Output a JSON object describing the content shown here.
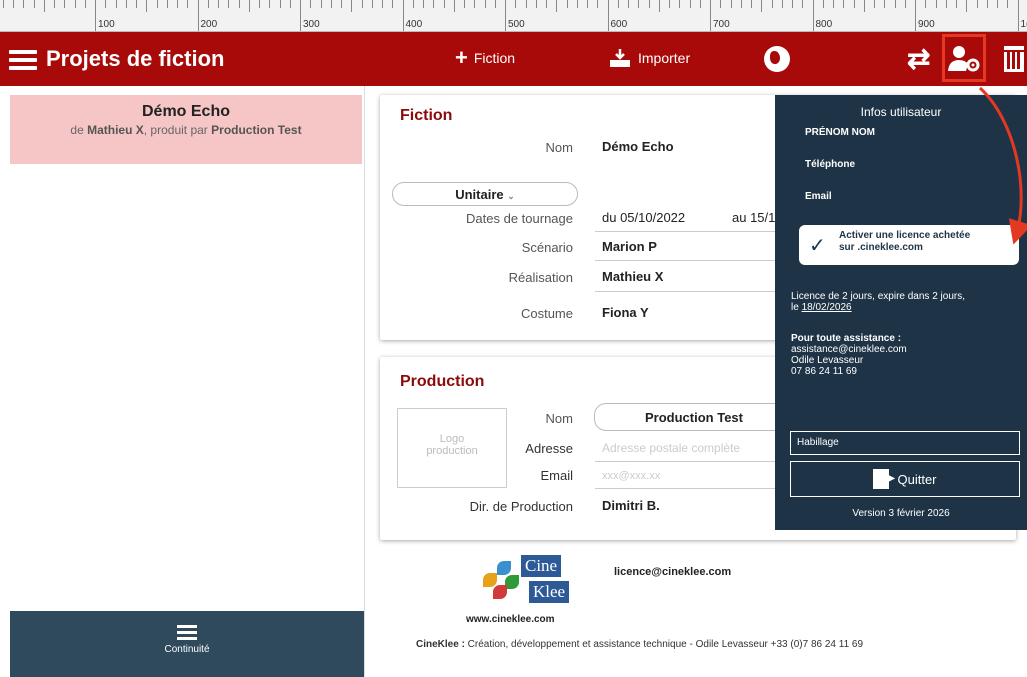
{
  "ruler": {
    "labels": [
      "100",
      "200",
      "300",
      "400",
      "500",
      "600",
      "700",
      "800",
      "900",
      "1("
    ]
  },
  "topbar": {
    "title": "Projets de fiction",
    "fiction_label": "Fiction",
    "import_label": "Importer",
    "icons": [
      "menu-icon",
      "plus-icon",
      "import-icon",
      "globe-icon",
      "swap-icon",
      "user-settings-icon",
      "trash-icon"
    ],
    "accent_color": "#a80a0a"
  },
  "sidebar": {
    "project": {
      "name": "Démo Echo",
      "sub_prefix": "de ",
      "director": "Mathieu X",
      "sub_mid": ", produit par ",
      "producer": "Production Test"
    },
    "continuite_label": "Continuité"
  },
  "fiction": {
    "title": "Fiction",
    "name_label": "Nom",
    "name_value": "Démo Echo",
    "type_value": "Unitaire",
    "dates_label": "Dates de tournage",
    "dates_from": "du 05/10/2022",
    "dates_to": "au 15/1",
    "scenario_label": "Scénario",
    "scenario_value": "Marion P",
    "realisation_label": "Réalisation",
    "realisation_value": "Mathieu X",
    "costume_label": "Costume",
    "costume_value": "Fiona Y"
  },
  "production": {
    "title": "Production",
    "logo_placeholder_1": "Logo",
    "logo_placeholder_2": "production",
    "name_label": "Nom",
    "name_value": "Production Test",
    "address_label": "Adresse",
    "address_placeholder": "Adresse postale complète",
    "email_label": "Email",
    "email_placeholder": "xxx@xxx.xx",
    "dir_label": "Dir. de Production",
    "dir_value": "Dimitri B."
  },
  "footer": {
    "logo_top": "Cine",
    "logo_bottom": "Klee",
    "email": "licence@cineklee.com",
    "url": "www.cineklee.com",
    "brand": "CineKlee :",
    "tagline": " Création, développement et assistance technique - Odile Levasseur +33 (0)7 86 24 11 69"
  },
  "user_panel": {
    "title": "Infos utilisateur",
    "name": "PRÉNOM NOM",
    "phone": "Téléphone",
    "email": "Email",
    "activate_line1": "Activer une licence achetée",
    "activate_line2": "sur                .cineklee.com",
    "licence_line1": "Licence de 2 jours, expire dans 2 jours,",
    "licence_line2_prefix": "le ",
    "licence_date": "18/02/2026",
    "support_title": "Pour toute assistance :",
    "support_email": "assistance@cineklee.com",
    "support_name": "Odile Levasseur",
    "support_phone": "07 86 24 11 69",
    "habillage": "Habillage",
    "quit": "Quitter",
    "version": "Version  3 février 2026",
    "bg_color": "#1e3446"
  }
}
